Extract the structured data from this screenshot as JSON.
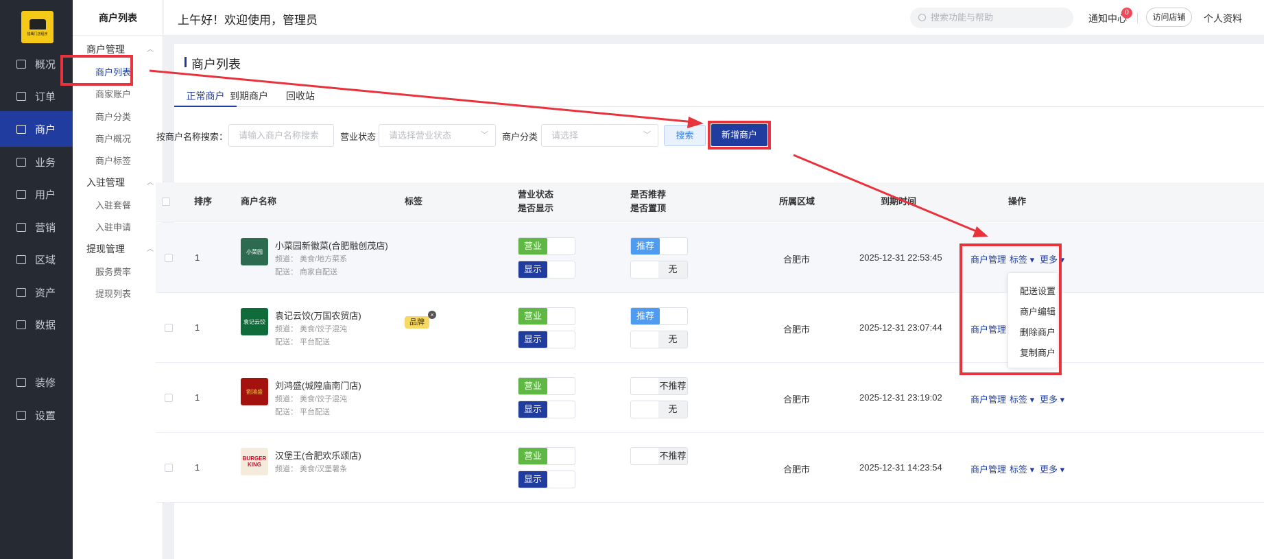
{
  "app": {
    "logo_text": "猎鹰门店程序"
  },
  "sidebar": {
    "items": [
      {
        "label": "概况",
        "icon": "dashboard-icon"
      },
      {
        "label": "订单",
        "icon": "order-icon"
      },
      {
        "label": "商户",
        "icon": "merchant-icon"
      },
      {
        "label": "业务",
        "icon": "business-icon"
      },
      {
        "label": "用户",
        "icon": "user-icon"
      },
      {
        "label": "营销",
        "icon": "marketing-icon"
      },
      {
        "label": "区域",
        "icon": "region-icon"
      },
      {
        "label": "资产",
        "icon": "asset-icon"
      },
      {
        "label": "数据",
        "icon": "data-icon"
      },
      {
        "label": "装修",
        "icon": "decor-icon"
      },
      {
        "label": "设置",
        "icon": "settings-icon"
      }
    ]
  },
  "submenu": {
    "title": "商户列表",
    "groups": [
      {
        "label": "商户管理",
        "items": [
          "商户列表",
          "商家账户",
          "商户分类",
          "商户概况",
          "商户标签"
        ]
      },
      {
        "label": "入驻管理",
        "items": [
          "入驻套餐",
          "入驻申请"
        ]
      },
      {
        "label": "提现管理",
        "items": [
          "服务费率",
          "提现列表"
        ]
      }
    ]
  },
  "header": {
    "greeting": "上午好！欢迎使用，管理员",
    "search_placeholder": "搜索功能与帮助",
    "notifications_label": "通知中心",
    "notifications_count": "0",
    "visit_store": "访问店铺",
    "profile": "个人资料"
  },
  "page": {
    "title": "商户列表",
    "tabs": [
      "正常商户",
      "到期商户",
      "回收站"
    ],
    "filters": {
      "name_label": "按商户名称搜索：",
      "name_placeholder": "请输入商户名称搜索",
      "status_label": "营业状态",
      "status_placeholder": "请选择营业状态",
      "category_label": "商户分类",
      "category_placeholder": "请选择",
      "search_button": "搜索",
      "add_button": "新增商户"
    }
  },
  "table": {
    "headers": {
      "sort": "排序",
      "name": "商户名称",
      "tag": "标签",
      "status1": "营业状态",
      "status2": "是否显示",
      "rec1": "是否推荐",
      "rec2": "是否置顶",
      "region": "所属区域",
      "expire": "到期时间",
      "ops": "操作"
    },
    "rows": [
      {
        "sort": "1",
        "name": "小菜园新徽菜(合肥融创茂店)",
        "channel": "频道： 美食/地方菜系",
        "delivery": "配送： 商家自配送",
        "tag": "",
        "logo_text": "小菜园",
        "logo_color": "#2d6b4f",
        "open": "营业",
        "show": "显示",
        "recommend": "推荐",
        "top": "无",
        "region": "合肥市",
        "expire": "2025-12-31 22:53:45"
      },
      {
        "sort": "1",
        "name": "袁记云饺(万国农贸店)",
        "channel": "频道： 美食/饺子混沌",
        "delivery": "配送： 平台配送",
        "tag": "品牌",
        "logo_text": "袁记云饺",
        "logo_color": "#0f6b3a",
        "open": "营业",
        "show": "显示",
        "recommend": "推荐",
        "top": "无",
        "region": "合肥市",
        "expire": "2025-12-31 23:07:44"
      },
      {
        "sort": "1",
        "name": "刘鸿盛(城隍庙南门店)",
        "channel": "频道： 美食/饺子混沌",
        "delivery": "配送： 平台配送",
        "tag": "",
        "logo_text": "劉鴻盛",
        "logo_color": "#a3120f",
        "open": "营业",
        "show": "显示",
        "recommend": "不推荐",
        "top": "无",
        "region": "合肥市",
        "expire": "2025-12-31 23:19:02"
      },
      {
        "sort": "1",
        "name": "汉堡王(合肥欢乐颂店)",
        "channel": "频道： 美食/汉堡薯条",
        "delivery": "",
        "tag": "",
        "logo_text": "BURGER KING",
        "logo_color": "#f5ebdc",
        "open": "营业",
        "show": "显示",
        "recommend": "不推荐",
        "top": "",
        "region": "合肥市",
        "expire": "2025-12-31 14:23:54"
      }
    ],
    "actions": {
      "manage": "商户管理",
      "tag": "标签",
      "more": "更多"
    }
  },
  "more_menu": [
    "配送设置",
    "商户编辑",
    "删除商户",
    "复制商户"
  ],
  "colors": {
    "primary": "#1f3c9e",
    "green": "#5fb843",
    "sidebar": "#252a33",
    "annotation": "#e8323c"
  }
}
